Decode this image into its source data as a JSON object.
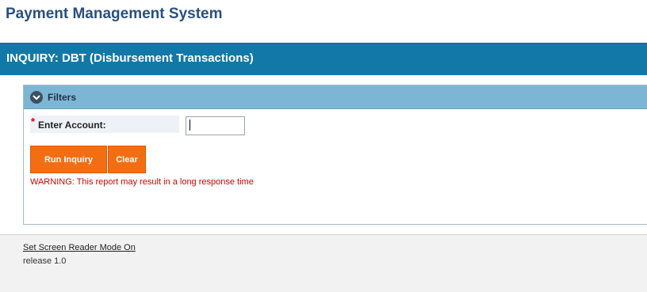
{
  "app": {
    "title": "Payment Management System"
  },
  "page": {
    "heading": "INQUIRY: DBT (Disbursement Transactions)"
  },
  "filters": {
    "title": "Filters",
    "toggle_icon": "chevron-down-icon",
    "required_marker": "*",
    "account_label": "Enter Account:",
    "account_value": "",
    "account_placeholder": ""
  },
  "actions": {
    "run_label": "Run Inquiry",
    "clear_label": "Clear"
  },
  "warning": {
    "text": "WARNING: This report may result in a long response time"
  },
  "footer": {
    "screen_reader_link": "Set Screen Reader Mode On",
    "release": "release 1.0"
  },
  "colors": {
    "brand_title": "#2a4f7f",
    "banner": "#1178a8",
    "panel_header": "#7db6d4",
    "button": "#f36e12",
    "warning": "#d40000"
  }
}
